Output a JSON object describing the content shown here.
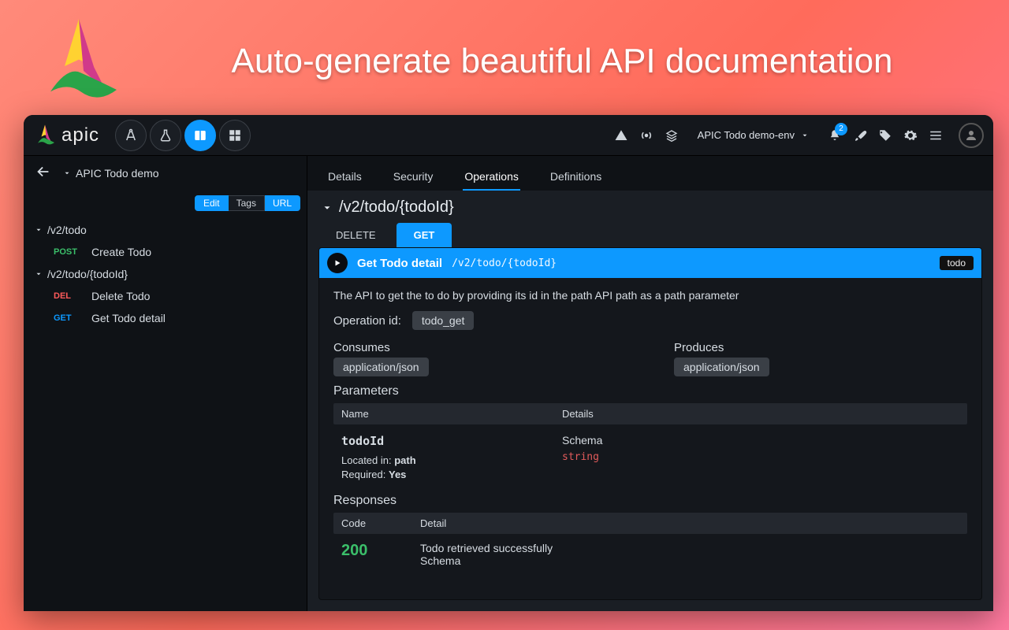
{
  "promo": {
    "title": "Auto-generate beautiful API documentation"
  },
  "brand": {
    "name": "apic"
  },
  "topbar": {
    "env_label": "APIC Todo demo-env",
    "notif_count": "2"
  },
  "crumb": {
    "project": "APIC Todo demo"
  },
  "content_tabs": {
    "details": "Details",
    "security": "Security",
    "operations": "Operations",
    "definitions": "Definitions",
    "active": "Operations"
  },
  "side_actions": {
    "edit": "Edit",
    "tags": "Tags",
    "url": "URL"
  },
  "tree": {
    "node1": {
      "path": "/v2/todo",
      "ops": [
        {
          "method": "POST",
          "label": "Create Todo"
        }
      ]
    },
    "node2": {
      "path": "/v2/todo/{todoId}",
      "ops": [
        {
          "method": "DEL",
          "label": "Delete Todo"
        },
        {
          "method": "GET",
          "label": "Get Todo detail"
        }
      ]
    }
  },
  "main": {
    "path": "/v2/todo/{todoId}",
    "method_tabs": {
      "delete": "DELETE",
      "get": "GET",
      "active": "GET"
    },
    "op": {
      "title": "Get Todo detail",
      "pathtext": "/v2/todo/{todoId}",
      "tag": "todo",
      "description": "The API to get the to do by providing its id in the path API path as a path parameter",
      "opid_label": "Operation id:",
      "opid_value": "todo_get",
      "consumes_label": "Consumes",
      "consumes_value": "application/json",
      "produces_label": "Produces",
      "produces_value": "application/json",
      "params_title": "Parameters",
      "params_head_name": "Name",
      "params_head_detail": "Details",
      "param": {
        "name": "todoId",
        "located_in_label": "Located in:",
        "located_in_value": "path",
        "required_label": "Required:",
        "required_value": "Yes",
        "schema_label": "Schema",
        "type": "string"
      },
      "responses_title": "Responses",
      "resp_head_code": "Code",
      "resp_head_detail": "Detail",
      "resp": {
        "code": "200",
        "desc": "Todo retrieved successfully",
        "schema_label": "Schema"
      }
    }
  }
}
